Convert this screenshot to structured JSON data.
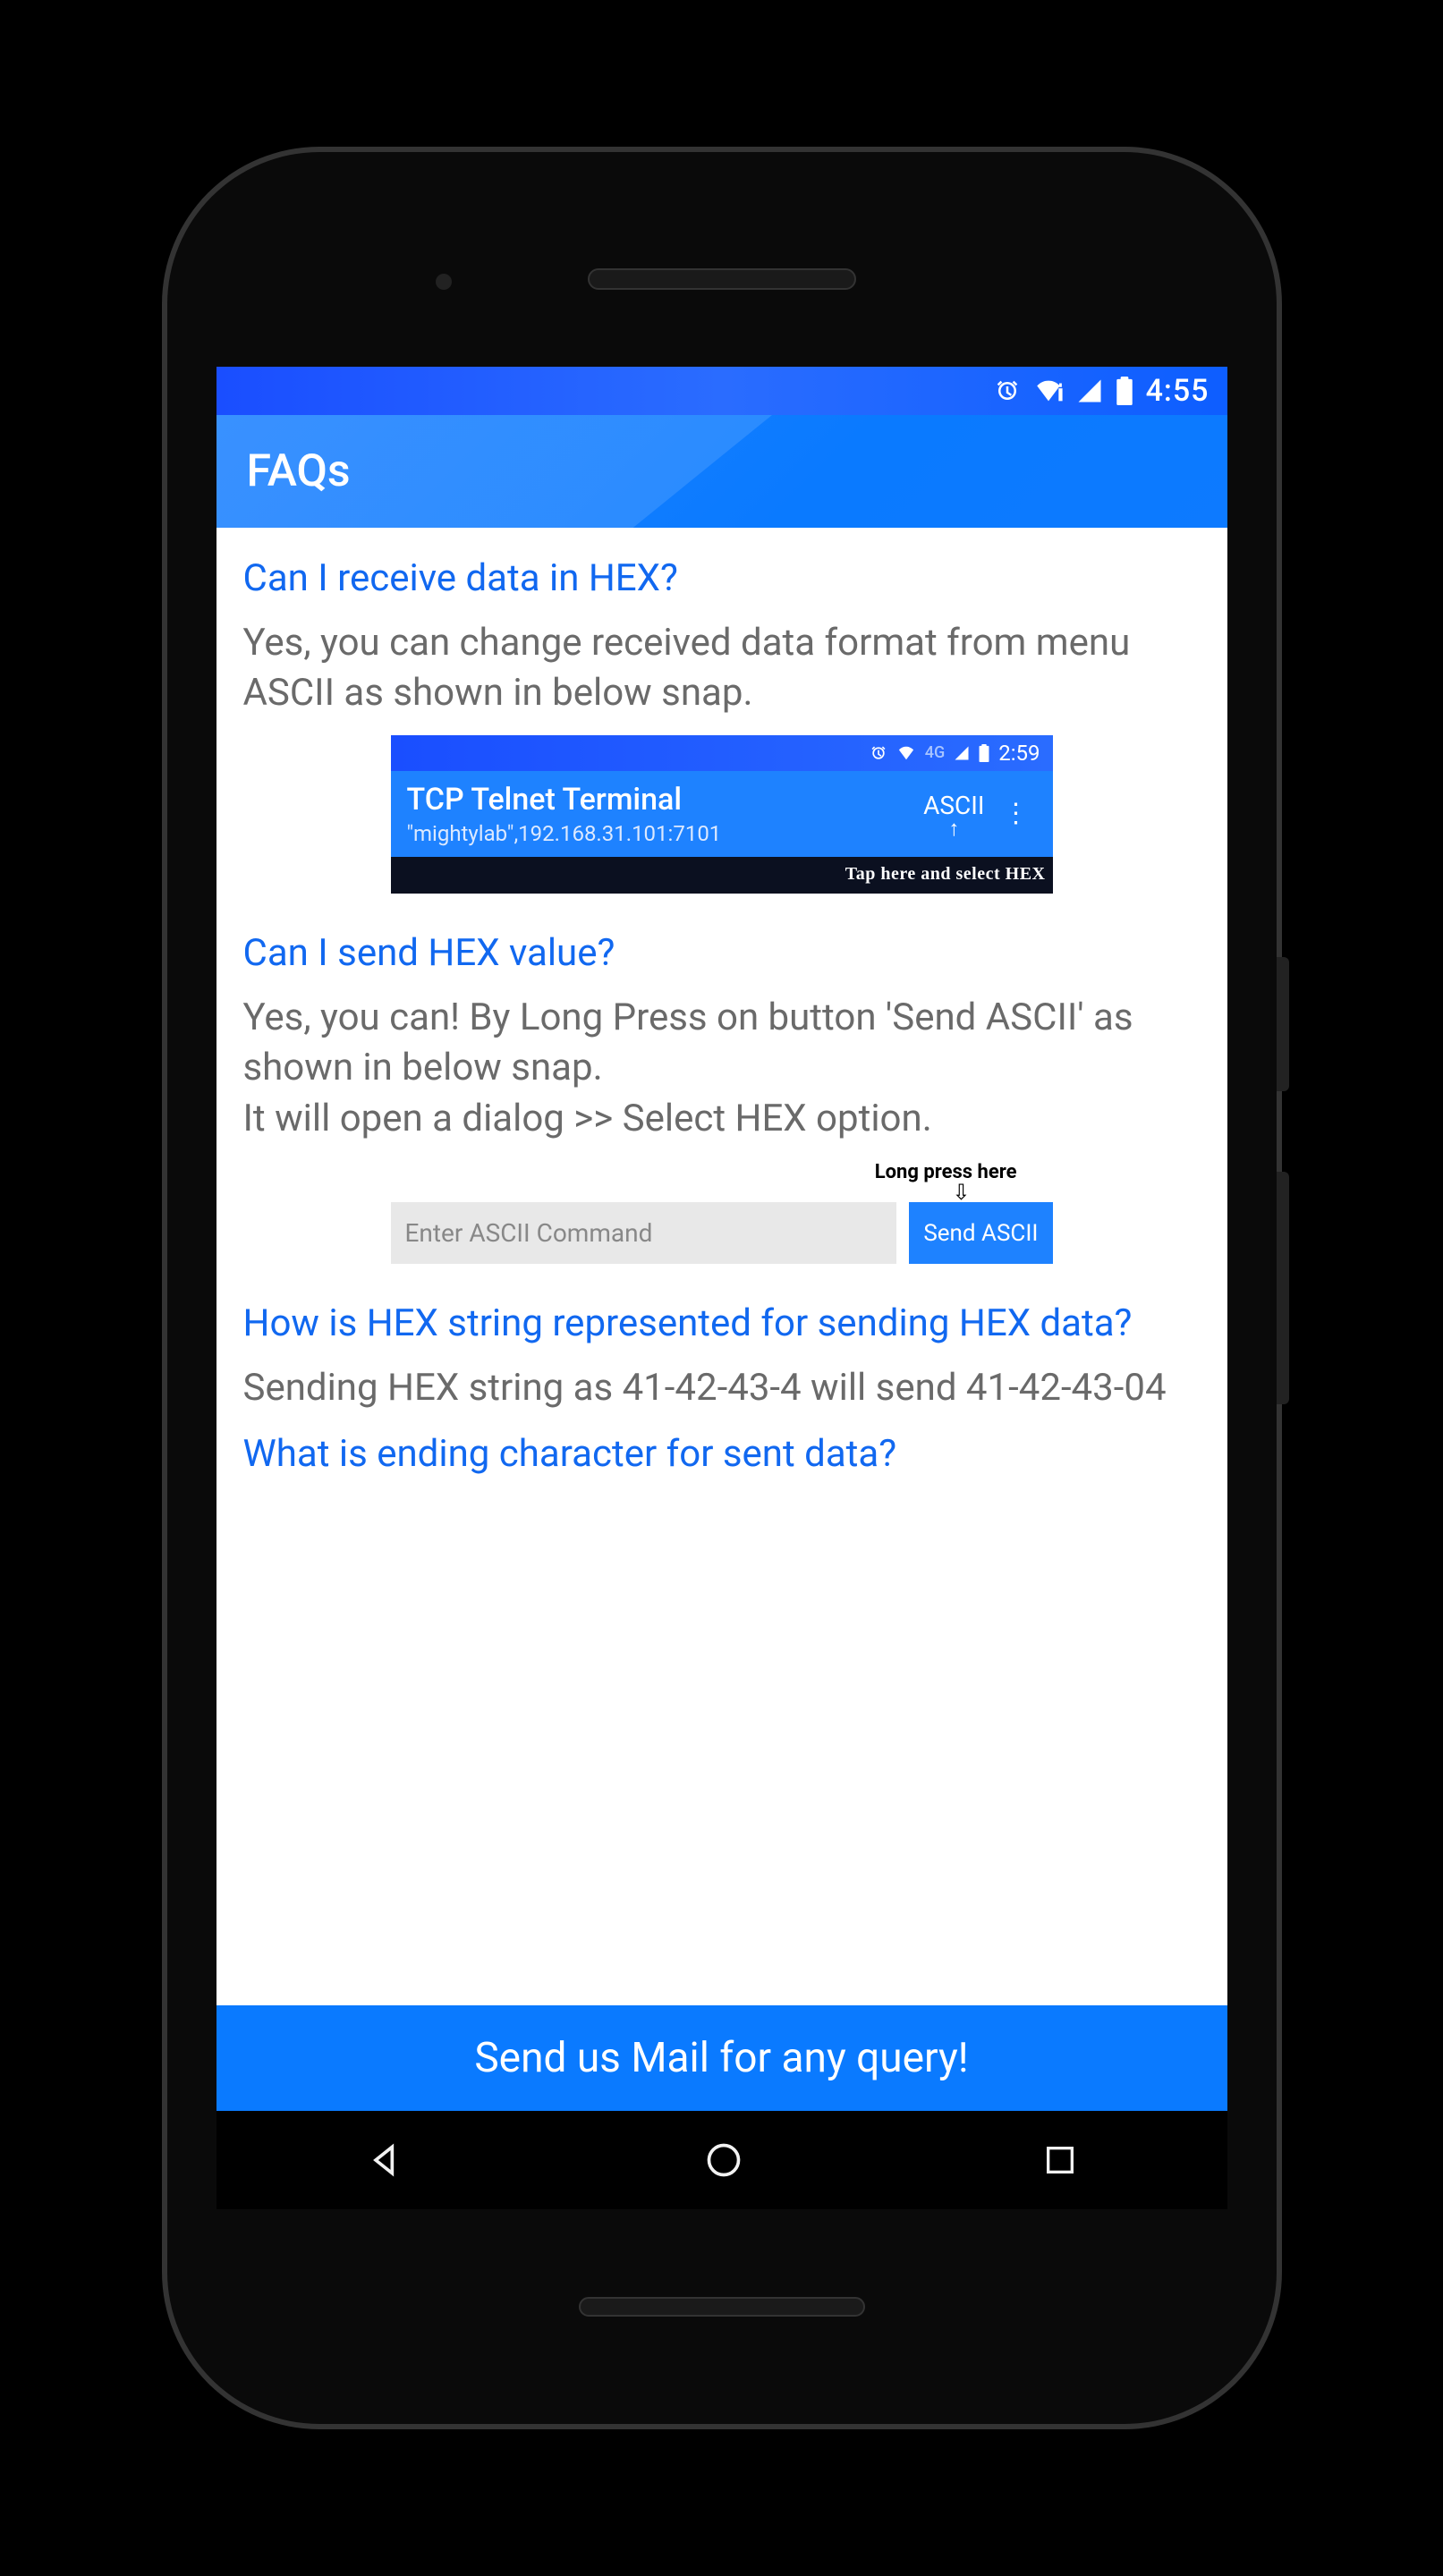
{
  "status": {
    "time": "4:55"
  },
  "app_bar": {
    "title": "FAQs"
  },
  "faq": [
    {
      "q": "Can I receive data in HEX?",
      "a": "Yes, you can change received data format from menu ASCII as shown in below snap."
    },
    {
      "q": "Can I send HEX value?",
      "a": "Yes, you can! By Long Press on button 'Send ASCII' as shown in below snap.\nIt will open a dialog >> Select HEX option."
    },
    {
      "q": "How is HEX string represented for sending HEX data?",
      "a": "Sending HEX string as 41-42-43-4 will send 41-42-43-04"
    },
    {
      "q": "What is ending character for sent data?",
      "a": ""
    }
  ],
  "snap1": {
    "status_time": "2:59",
    "status_net": "4G",
    "title": "TCP Telnet Terminal",
    "subtitle": "\"mightylab\",192.168.31.101:7101",
    "ascii_label": "ASCII",
    "hint": "Tap here and select HEX"
  },
  "snap2": {
    "hint": "Long press here",
    "input_placeholder": "Enter ASCII Command",
    "button_label": "Send ASCII"
  },
  "mail_button": "Send us Mail for any query!"
}
